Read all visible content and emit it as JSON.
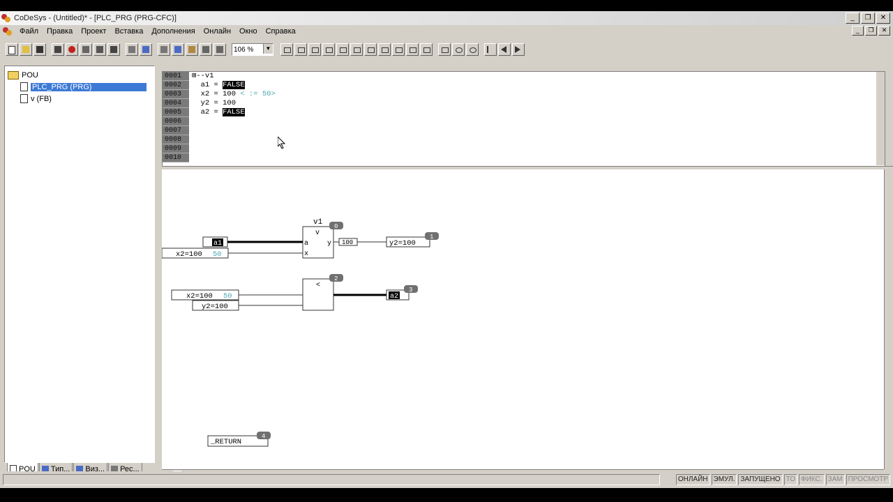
{
  "window": {
    "title": "CoDeSys - (Untitled)* - [PLC_PRG (PRG-CFC)]",
    "controls": {
      "minimize": "_",
      "restore": "❐",
      "close": "✕"
    }
  },
  "menu": [
    "Файл",
    "Правка",
    "Проект",
    "Вставка",
    "Дополнения",
    "Онлайн",
    "Окно",
    "Справка"
  ],
  "toolbar": {
    "zoom": "106 %"
  },
  "tree": {
    "root": "POU",
    "items": [
      {
        "label": "PLC_PRG (PRG)",
        "selected": true
      },
      {
        "label": "v (FB)",
        "selected": false
      }
    ]
  },
  "left_tabs": [
    "POU",
    "Тип...",
    "Виз...",
    "Рес..."
  ],
  "declarations": {
    "line_numbers": [
      "0001",
      "0002",
      "0003",
      "0004",
      "0005",
      "0006",
      "0007",
      "0008",
      "0009",
      "0010"
    ],
    "rows": [
      {
        "text": "⊞--v1"
      },
      {
        "name": "  a1 = ",
        "value": "FALSE"
      },
      {
        "name": "  x2 = 100 ",
        "comment": "< := 50>"
      },
      {
        "name": "  y2 = 100"
      },
      {
        "name": "  a2 = ",
        "value": "FALSE"
      }
    ]
  },
  "cfc": {
    "fb_instance": "v1",
    "fb_type": "v",
    "fb_inputs": [
      "a",
      "x"
    ],
    "fb_output": "y",
    "fb_order": "0",
    "input_a1": "a1",
    "input_x2_name": "x2=100",
    "input_x2_value": "50",
    "output_value": "100",
    "output_y2": "y2=100",
    "output_y2_order": "1",
    "cmp_op": "<",
    "cmp_order": "2",
    "cmp_in1_name": "x2=100",
    "cmp_in1_value": "50",
    "cmp_in2": "y2=100",
    "cmp_out": "a2",
    "cmp_out_order": "3",
    "return_label": "_RETURN",
    "return_order": "4"
  },
  "status": {
    "items": [
      {
        "label": "ОНЛАЙН",
        "active": true
      },
      {
        "label": "ЭМУЛ.",
        "active": true
      },
      {
        "label": "ЗАПУЩЕНО",
        "active": true
      },
      {
        "label": "ТО",
        "active": false
      },
      {
        "label": "ФИКС.",
        "active": false
      },
      {
        "label": "ЗАМ",
        "active": false
      },
      {
        "label": "ПРОСМОТР",
        "active": false
      }
    ]
  }
}
